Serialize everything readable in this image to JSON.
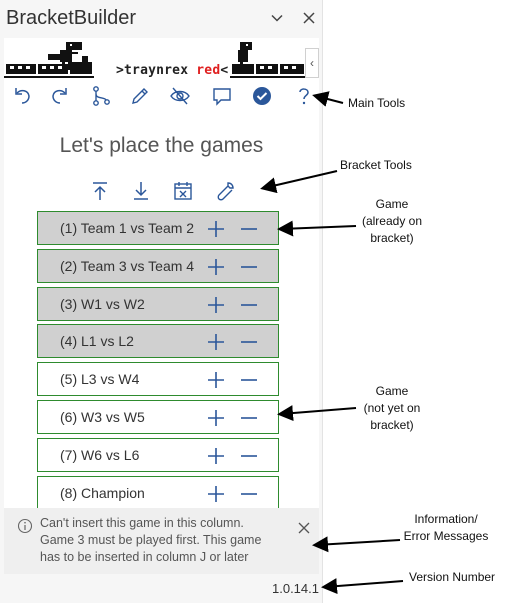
{
  "pane": {
    "title": "BracketBuilder"
  },
  "banner": {
    "prefix": ">traynrex ",
    "accent": "red",
    "suffix": "<"
  },
  "heading": "Let's place the games",
  "games": [
    {
      "label": "(1)  Team 1 vs Team 2",
      "placed": true
    },
    {
      "label": "(2)  Team 3 vs Team 4",
      "placed": true
    },
    {
      "label": "(3)  W1 vs W2",
      "placed": true
    },
    {
      "label": "(4)  L1 vs L2",
      "placed": true
    },
    {
      "label": "(5)  L3 vs W4",
      "placed": false
    },
    {
      "label": "(6)  W3 vs W5",
      "placed": false
    },
    {
      "label": "(7)  W6 vs L6",
      "placed": false
    },
    {
      "label": "(8)  Champion",
      "placed": false
    }
  ],
  "message": {
    "text": "Can't insert this game in this column. Game 3 must be played first. This game has to be inserted in column J or later"
  },
  "version": "1.0.14.1",
  "annotations": {
    "main_tools": "Main Tools",
    "bracket_tools": "Bracket Tools",
    "game_on_bracket": [
      "Game",
      "(already on",
      "bracket)"
    ],
    "game_not_on_bracket": [
      "Game",
      "(not yet on",
      "bracket)"
    ],
    "info_messages": [
      "Information/",
      "Error Messages"
    ],
    "version_number": "Version Number"
  },
  "colors": {
    "accent_blue": "#2b579a",
    "game_border": "#2e8b2e",
    "placed_fill": "#d0d0d0",
    "banner_red": "#e02020"
  }
}
